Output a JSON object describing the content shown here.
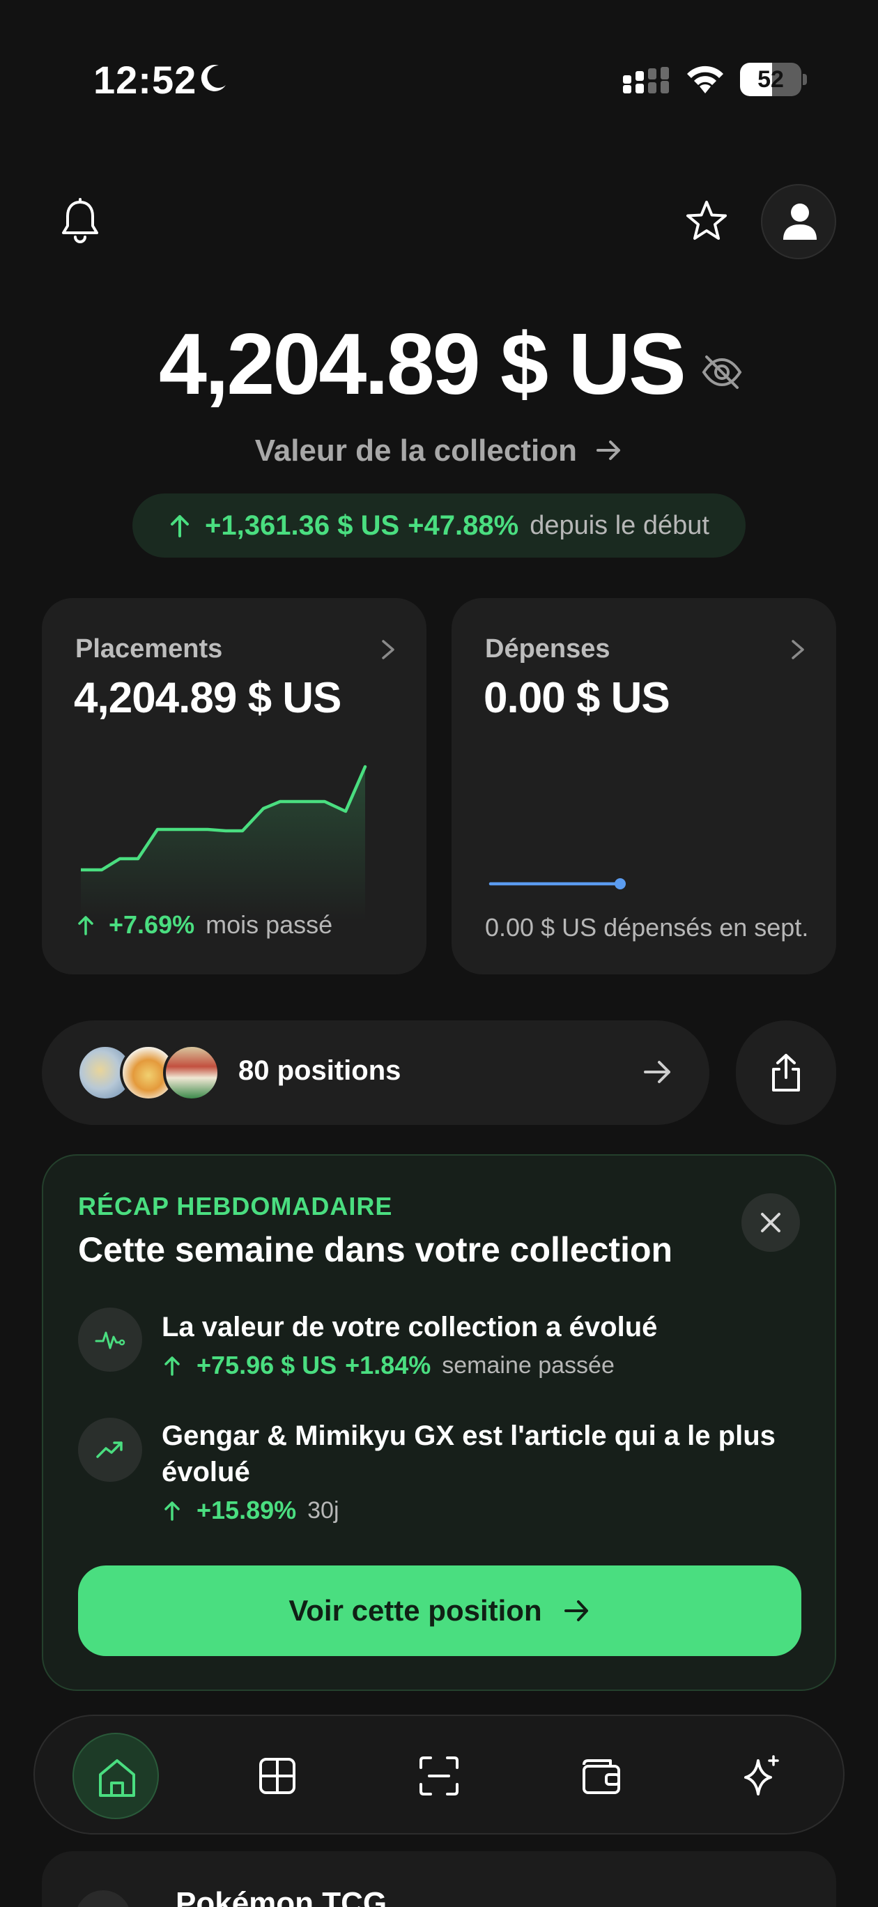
{
  "status_bar": {
    "time": "12:52",
    "battery": "52",
    "battery_level": 0.52
  },
  "hero": {
    "value": "4,204.89 $ US",
    "label": "Valeur de la collection",
    "gain_amount": "+1,361.36 $ US",
    "gain_percent": "+47.88%",
    "gain_since": "depuis le début"
  },
  "placements": {
    "label": "Placements",
    "value": "4,204.89 $ US",
    "change_percent": "+7.69%",
    "change_period": "mois passé"
  },
  "depenses": {
    "label": "Dépenses",
    "value": "0.00 $ US",
    "footer": "0.00 $ US dépensés en sept."
  },
  "positions": {
    "label": "80 positions"
  },
  "recap": {
    "tag": "RÉCAP HEBDOMADAIRE",
    "title": "Cette semaine dans votre collection",
    "items": [
      {
        "title": "La valeur de votre collection a évolué",
        "amount": "+75.96 $ US",
        "percent": "+1.84%",
        "period": "semaine passée"
      },
      {
        "title": "Gengar & Mimikyu GX est l'article qui a le plus évolué",
        "amount": "+15.89%",
        "period": "30j"
      }
    ],
    "button_label": "Voir cette position"
  },
  "peek": {
    "label": "Pokémon TCG"
  },
  "colors": {
    "accent_green": "#4ade80",
    "background": "#121212",
    "card": "#1f1f1f",
    "spend_line": "#5b9cf0"
  },
  "icons": {
    "top_left": "bell-icon",
    "top_right": [
      "star-icon",
      "user-icon"
    ],
    "nav": [
      "home-icon",
      "grid-icon",
      "scan-icon",
      "wallet-icon",
      "sparkle-icon"
    ]
  }
}
